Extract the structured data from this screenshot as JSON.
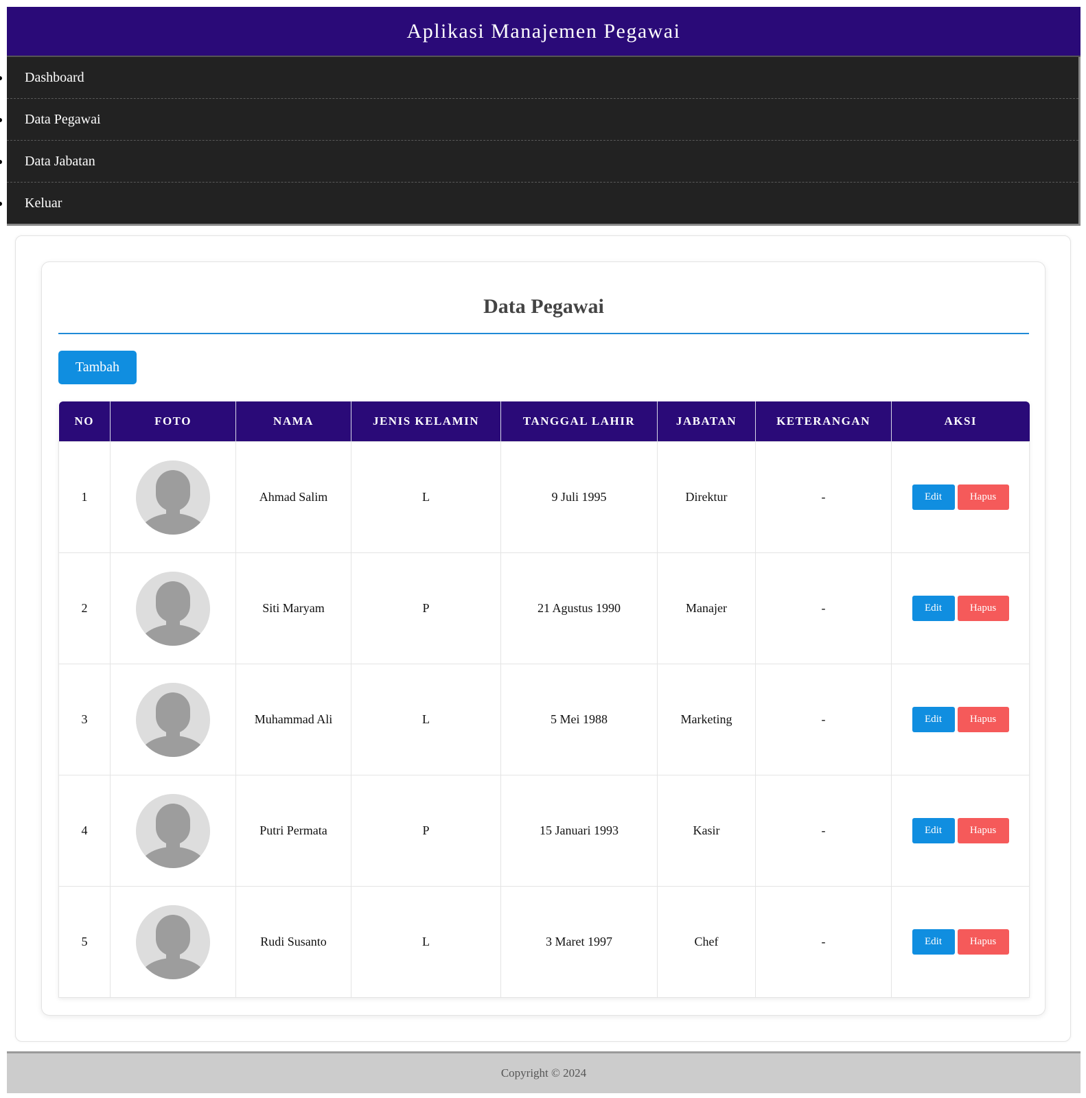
{
  "app": {
    "title": "Aplikasi Manajemen Pegawai"
  },
  "nav": {
    "items": [
      {
        "label": "Dashboard"
      },
      {
        "label": "Data Pegawai"
      },
      {
        "label": "Data Jabatan"
      },
      {
        "label": "Keluar"
      }
    ]
  },
  "main": {
    "title": "Data Pegawai",
    "add_button": "Tambah",
    "table": {
      "headers": [
        "NO",
        "FOTO",
        "NAMA",
        "JENIS KELAMIN",
        "TANGGAL LAHIR",
        "JABATAN",
        "KETERANGAN",
        "AKSI"
      ],
      "rows": [
        {
          "no": "1",
          "nama": "Ahmad Salim",
          "jk": "L",
          "tgl": "9 Juli 1995",
          "jabatan": "Direktur",
          "ket": "-",
          "edit": "Edit",
          "hapus": "Hapus"
        },
        {
          "no": "2",
          "nama": "Siti Maryam",
          "jk": "P",
          "tgl": "21 Agustus 1990",
          "jabatan": "Manajer",
          "ket": "-",
          "edit": "Edit",
          "hapus": "Hapus"
        },
        {
          "no": "3",
          "nama": "Muhammad Ali",
          "jk": "L",
          "tgl": "5 Mei 1988",
          "jabatan": "Marketing",
          "ket": "-",
          "edit": "Edit",
          "hapus": "Hapus"
        },
        {
          "no": "4",
          "nama": "Putri Permata",
          "jk": "P",
          "tgl": "15 Januari 1993",
          "jabatan": "Kasir",
          "ket": "-",
          "edit": "Edit",
          "hapus": "Hapus"
        },
        {
          "no": "5",
          "nama": "Rudi Susanto",
          "jk": "L",
          "tgl": "3 Maret 1997",
          "jabatan": "Chef",
          "ket": "-",
          "edit": "Edit",
          "hapus": "Hapus"
        }
      ]
    }
  },
  "footer": {
    "text": "Copyright © 2024"
  },
  "colors": {
    "header_bg": "#2a0a78",
    "nav_bg": "#222222",
    "accent_blue": "#108ee0",
    "danger_red": "#f55a5a",
    "footer_bg": "#cccccc"
  },
  "icons": {
    "avatar": "user-placeholder-icon"
  }
}
